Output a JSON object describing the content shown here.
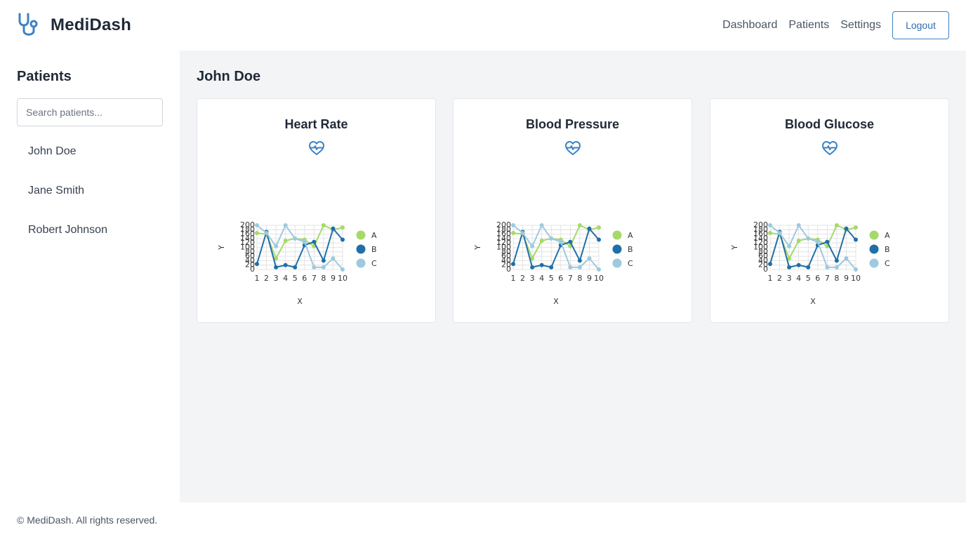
{
  "app": {
    "name": "MediDash",
    "logo_icon": "stethoscope-icon",
    "accent_color": "#3b82c4"
  },
  "nav": {
    "items": [
      "Dashboard",
      "Patients",
      "Settings"
    ],
    "logout_label": "Logout"
  },
  "sidebar": {
    "title": "Patients",
    "search_placeholder": "Search patients...",
    "patients": [
      "John Doe",
      "Jane Smith",
      "Robert Johnson"
    ]
  },
  "main": {
    "patient_name": "John Doe",
    "cards": [
      {
        "title": "Heart Rate",
        "icon": "heart-pulse-icon"
      },
      {
        "title": "Blood Pressure",
        "icon": "heart-pulse-icon"
      },
      {
        "title": "Blood Glucose",
        "icon": "heart-pulse-icon"
      }
    ]
  },
  "footer": {
    "text": "© MediDash. All rights reserved."
  },
  "chart_data": [
    {
      "type": "line",
      "xlabel": "X",
      "ylabel": "Y",
      "x": [
        1,
        2,
        3,
        4,
        5,
        6,
        7,
        8,
        9,
        10
      ],
      "ylim": [
        0,
        200
      ],
      "yticks": [
        0,
        20,
        40,
        60,
        80,
        100,
        120,
        140,
        160,
        180,
        200
      ],
      "grid": true,
      "legend": "right",
      "series": [
        {
          "name": "A",
          "color": "#a6d96a",
          "values": [
            165,
            160,
            50,
            130,
            140,
            135,
            105,
            200,
            180,
            190
          ]
        },
        {
          "name": "B",
          "color": "#1f6fa8",
          "values": [
            25,
            170,
            10,
            20,
            10,
            110,
            125,
            40,
            185,
            135
          ]
        },
        {
          "name": "C",
          "color": "#9ec9df",
          "values": [
            200,
            165,
            105,
            200,
            140,
            125,
            10,
            10,
            50,
            0
          ]
        }
      ]
    },
    {
      "type": "line",
      "xlabel": "X",
      "ylabel": "Y",
      "x": [
        1,
        2,
        3,
        4,
        5,
        6,
        7,
        8,
        9,
        10
      ],
      "ylim": [
        0,
        200
      ],
      "yticks": [
        0,
        20,
        40,
        60,
        80,
        100,
        120,
        140,
        160,
        180,
        200
      ],
      "grid": true,
      "legend": "right",
      "series": [
        {
          "name": "A",
          "color": "#a6d96a",
          "values": [
            165,
            160,
            50,
            130,
            140,
            135,
            105,
            200,
            180,
            190
          ]
        },
        {
          "name": "B",
          "color": "#1f6fa8",
          "values": [
            25,
            170,
            10,
            20,
            10,
            110,
            125,
            40,
            185,
            135
          ]
        },
        {
          "name": "C",
          "color": "#9ec9df",
          "values": [
            200,
            165,
            105,
            200,
            140,
            125,
            10,
            10,
            50,
            0
          ]
        }
      ]
    },
    {
      "type": "line",
      "xlabel": "X",
      "ylabel": "Y",
      "x": [
        1,
        2,
        3,
        4,
        5,
        6,
        7,
        8,
        9,
        10
      ],
      "ylim": [
        0,
        200
      ],
      "yticks": [
        0,
        20,
        40,
        60,
        80,
        100,
        120,
        140,
        160,
        180,
        200
      ],
      "grid": true,
      "legend": "right",
      "series": [
        {
          "name": "A",
          "color": "#a6d96a",
          "values": [
            165,
            160,
            50,
            130,
            140,
            135,
            105,
            200,
            180,
            190
          ]
        },
        {
          "name": "B",
          "color": "#1f6fa8",
          "values": [
            25,
            170,
            10,
            20,
            10,
            110,
            125,
            40,
            185,
            135
          ]
        },
        {
          "name": "C",
          "color": "#9ec9df",
          "values": [
            200,
            165,
            105,
            200,
            140,
            125,
            10,
            10,
            50,
            0
          ]
        }
      ]
    }
  ]
}
